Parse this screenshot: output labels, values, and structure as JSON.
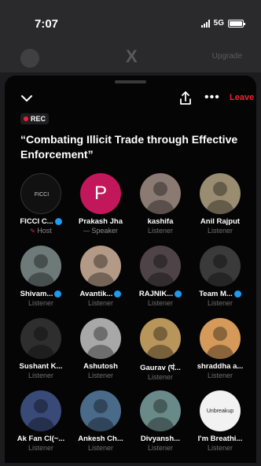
{
  "status": {
    "time": "7:07",
    "network": "5G"
  },
  "background": {
    "upgrade_label": "Upgrade",
    "logo": "X"
  },
  "topbar": {
    "leave_label": "Leave"
  },
  "rec_label": "REC",
  "title": "“Combating Illicit Trade through Effective Enforcement”",
  "participants": [
    {
      "name": "FICCI C...",
      "role": "Host",
      "verified": true,
      "avatar_label": "FICCI",
      "color": "#1a1a1a"
    },
    {
      "name": "Prakash Jha",
      "role": "Speaker",
      "verified": false,
      "avatar_label": "P",
      "color": "#c2185b"
    },
    {
      "name": "kashifa",
      "role": "Listener",
      "verified": false,
      "color": "#8a7a72"
    },
    {
      "name": "Anil Rajput",
      "role": "Listener",
      "verified": false,
      "color": "#9a8c70"
    },
    {
      "name": "Shivam...",
      "role": "Listener",
      "verified": true,
      "color": "#6e7a78"
    },
    {
      "name": "Avantik...",
      "role": "Listener",
      "verified": true,
      "color": "#b29a86"
    },
    {
      "name": "RAJNIK...",
      "role": "Listener",
      "verified": true,
      "color": "#4e4448"
    },
    {
      "name": "Team M...",
      "role": "Listener",
      "verified": true,
      "color": "#3a3a3a"
    },
    {
      "name": "Sushant K...",
      "role": "Listener",
      "verified": false,
      "color": "#2e2e2e"
    },
    {
      "name": "Ashutosh",
      "role": "Listener",
      "verified": false,
      "color": "#a8a8a8"
    },
    {
      "name": "Gaurav (पं...",
      "role": "Listener",
      "verified": false,
      "color": "#b8955a"
    },
    {
      "name": "shraddha a...",
      "role": "Listener",
      "verified": false,
      "color": "#d59a5a"
    },
    {
      "name": "Ak Fan Cl(~...",
      "role": "Listener",
      "verified": false,
      "color": "#3a4a78"
    },
    {
      "name": "Ankesh Ch...",
      "role": "Listener",
      "verified": false,
      "color": "#4a6a8a"
    },
    {
      "name": "Divyansh...",
      "role": "Listener",
      "verified": false,
      "color": "#6a8a8a"
    },
    {
      "name": "I'm Breathi...",
      "role": "Listener",
      "verified": false,
      "avatar_label": "Unbreakup",
      "color": "#f2f2f2"
    }
  ],
  "icons": {
    "back": "chevron-down-icon",
    "share": "share-icon",
    "more": "more-dots-icon",
    "verified": "verified-badge-icon",
    "host": "host-icon",
    "speaker": "speaker-icon"
  },
  "colors": {
    "accent": "#1d9bf0",
    "leave": "#f4212e",
    "sheet": "#050505"
  }
}
